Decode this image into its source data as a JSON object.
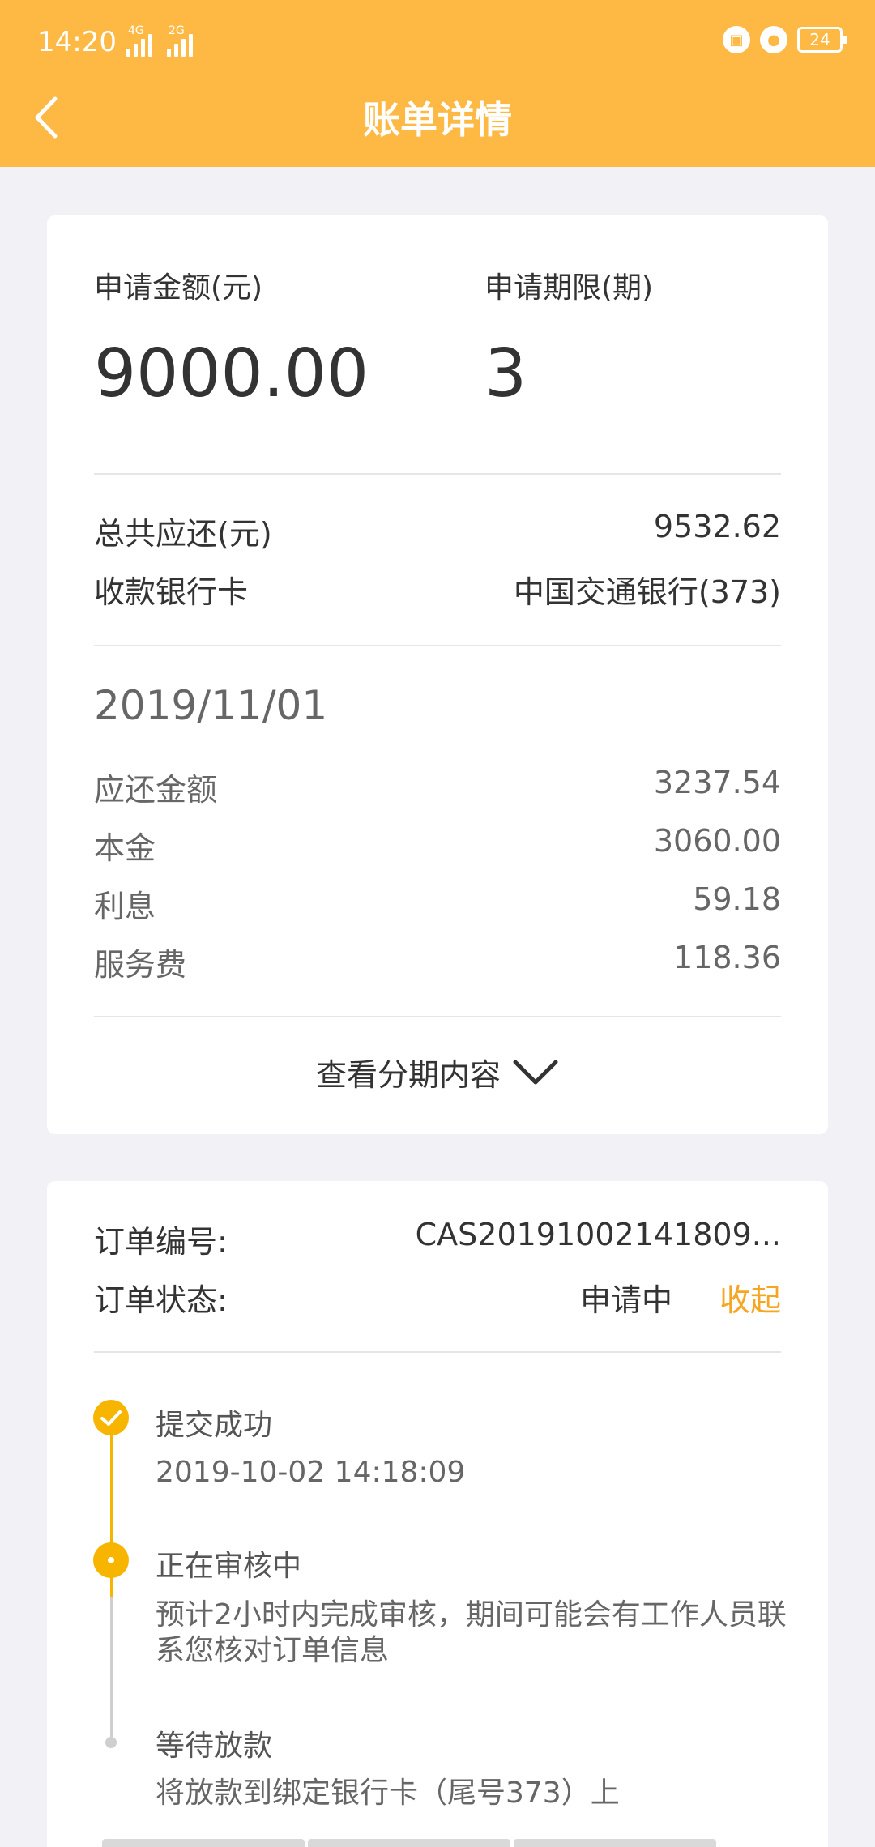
{
  "status": {
    "time": "14:20",
    "sig1_tag": "4G",
    "sig2_tag": "2G",
    "battery": "24"
  },
  "header": {
    "title": "账单详情"
  },
  "summary": {
    "amount_label": "申请金额(元)",
    "amount_value": "9000.00",
    "term_label": "申请期限(期)",
    "term_value": "3",
    "total_label": "总共应还(元)",
    "total_value": "9532.62",
    "card_label": "收款银行卡",
    "card_value": "中国交通银行(373)"
  },
  "installment": {
    "date": "2019/11/01",
    "rows": [
      {
        "label": "应还金额",
        "value": "3237.54"
      },
      {
        "label": "本金",
        "value": "3060.00"
      },
      {
        "label": "利息",
        "value": "59.18"
      },
      {
        "label": "服务费",
        "value": "118.36"
      }
    ],
    "expand_label": "查看分期内容"
  },
  "order": {
    "number_label": "订单编号:",
    "number_value": "CAS20191002141809...",
    "status_label": "订单状态:",
    "status_value": "申请中",
    "collapse_label": "收起"
  },
  "timeline": [
    {
      "title": "提交成功",
      "desc": "2019-10-02 14:18:09"
    },
    {
      "title": "正在审核中",
      "desc": "预计2小时内完成审核，期间可能会有工作人员联系您核对订单信息"
    },
    {
      "title": "等待放款",
      "desc": "将放款到绑定银行卡（尾号373）上"
    }
  ],
  "colors": {
    "header": "#FDB943",
    "accent": "#F5A623"
  }
}
